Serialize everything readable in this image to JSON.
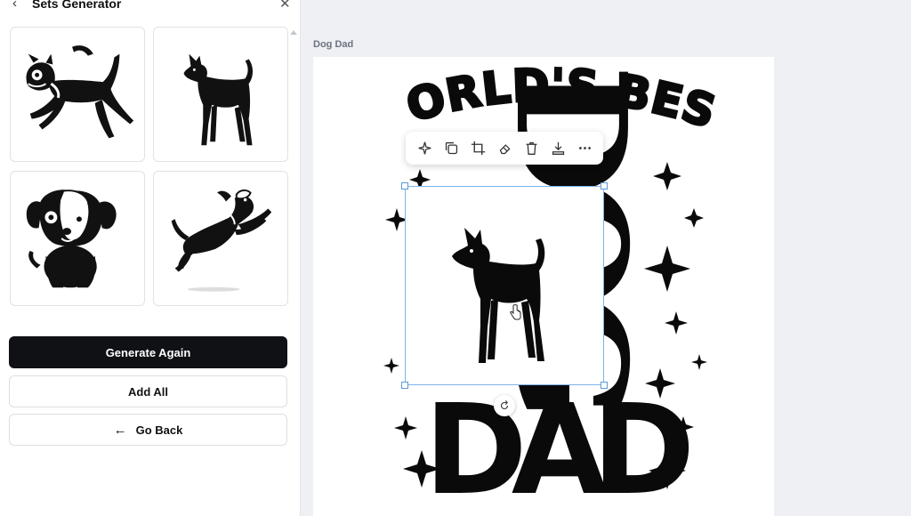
{
  "panel": {
    "title": "Sets Generator",
    "back_icon": "chevron-left-icon",
    "close_icon": "close-icon",
    "thumbnails": [
      {
        "name": "running-terrier-dog"
      },
      {
        "name": "standing-dog"
      },
      {
        "name": "sitting-puppy"
      },
      {
        "name": "jumping-dog"
      }
    ],
    "buttons": {
      "generate_again": "Generate Again",
      "add_all": "Add All",
      "go_back": "Go Back"
    }
  },
  "canvas": {
    "document_label": "Dog Dad",
    "design_text": {
      "top": "WORLD'S BEST",
      "middle": "DOG",
      "bottom": "DAD"
    },
    "toolbar": [
      {
        "name": "magic-icon"
      },
      {
        "name": "duplicate-icon"
      },
      {
        "name": "crop-icon"
      },
      {
        "name": "eraser-icon"
      },
      {
        "name": "delete-icon"
      },
      {
        "name": "download-icon"
      },
      {
        "name": "more-icon"
      }
    ]
  },
  "colors": {
    "primary_button": "#0f1115",
    "selection_border": "#7fb3e6",
    "artwork": "#0a0a0a"
  }
}
